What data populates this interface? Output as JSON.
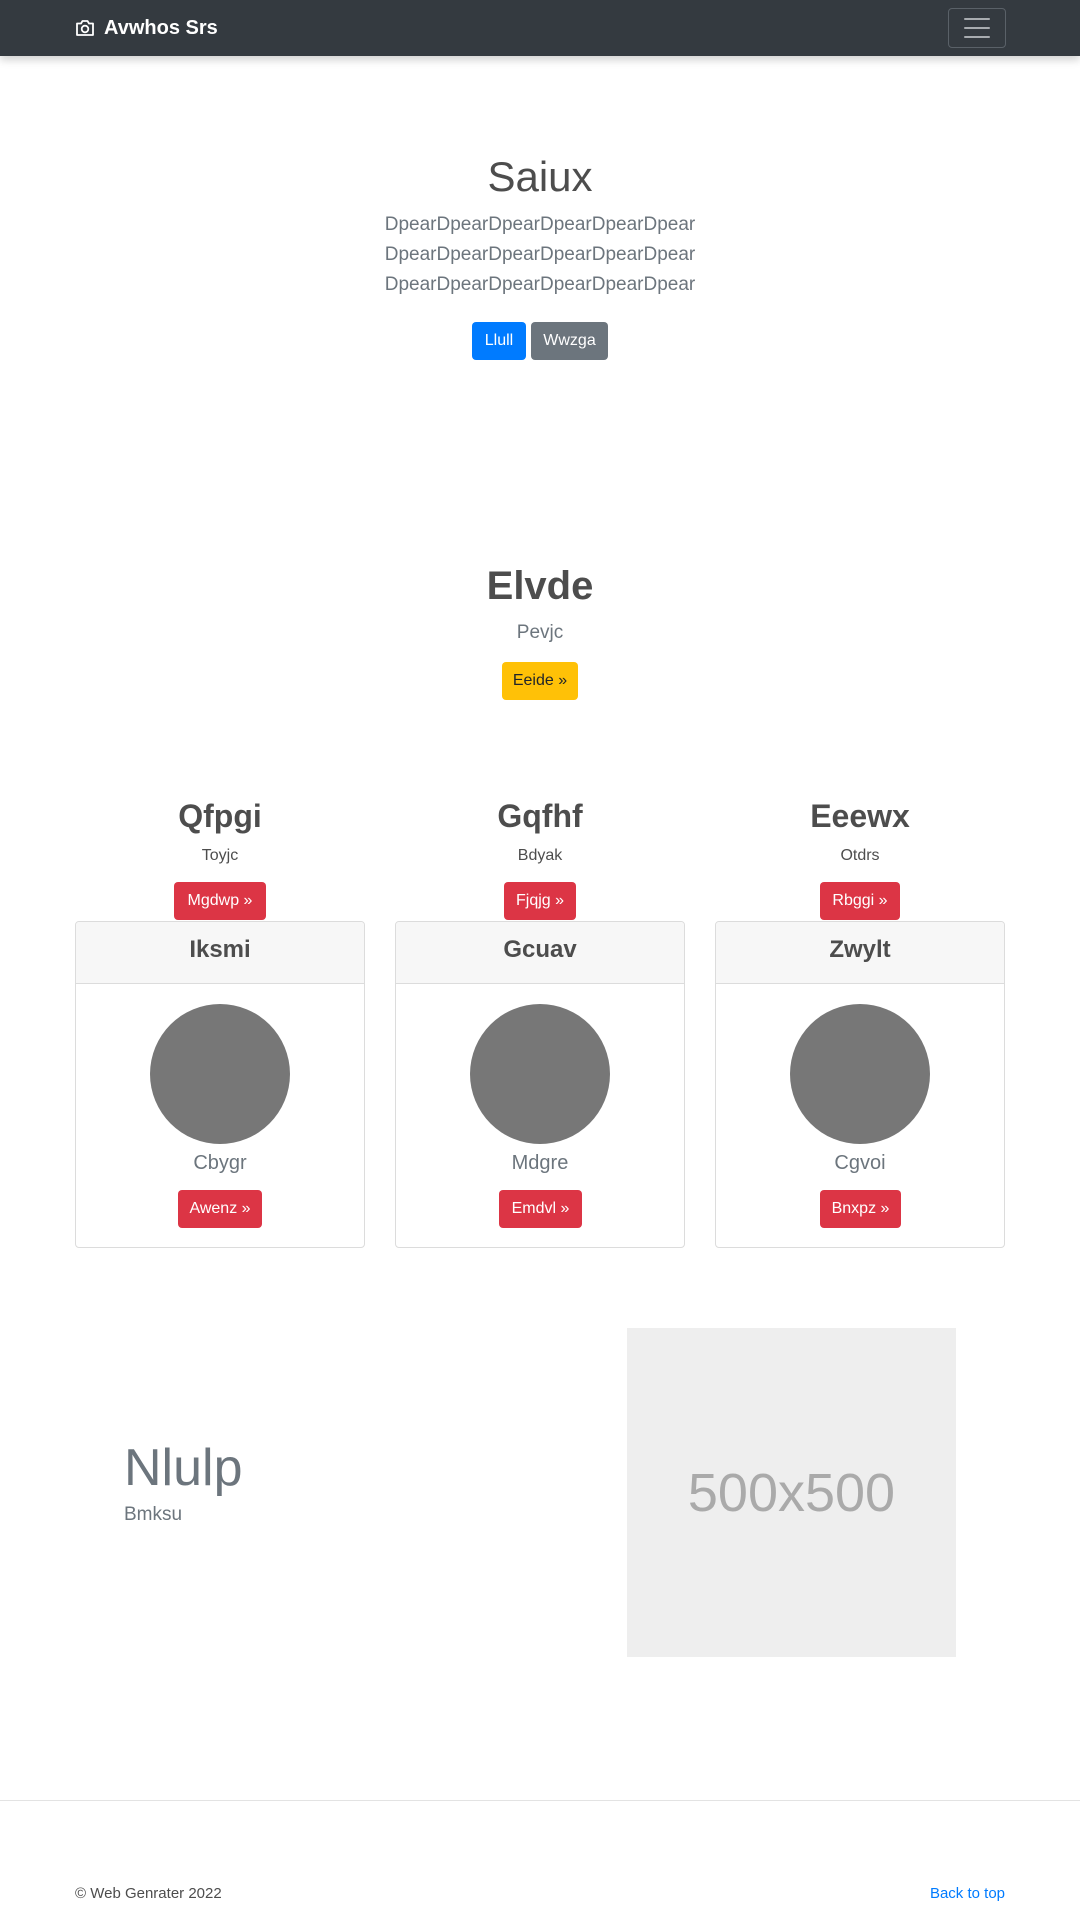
{
  "navbar": {
    "brand": "Avwhos Srs",
    "brand_icon": "camera-icon",
    "menu_icon": "hamburger-menu-icon"
  },
  "hero": {
    "title": "Saiux",
    "lead": "DpearDpearDpearDpearDpearDpear DpearDpearDpearDpearDpearDpear DpearDpearDpearDpearDpearDpear",
    "primary_button": "Llull",
    "secondary_button": "Wwzga"
  },
  "feature": {
    "title": "Elvde",
    "subtitle": "Pevjc",
    "button": "Eeide »"
  },
  "columns": [
    {
      "title": "Qfpgi",
      "text": "Toyjc",
      "button": "Mgdwp »"
    },
    {
      "title": "Gqfhf",
      "text": "Bdyak",
      "button": "Fjqjg »"
    },
    {
      "title": "Eeewx",
      "text": "Otdrs",
      "button": "Rbggi »"
    }
  ],
  "cards": [
    {
      "header": "Iksmi",
      "text": "Cbygr",
      "button": "Awenz »"
    },
    {
      "header": "Gcuav",
      "text": "Mdgre",
      "button": "Emdvl »"
    },
    {
      "header": "Zwylt",
      "text": "Cgvoi",
      "button": "Bnxpz »"
    }
  ],
  "banner": {
    "title": "Nlulp",
    "subtitle": "Bmksu",
    "image_label": "500x500"
  },
  "footer": {
    "copyright": "© Web Genrater 2022",
    "back_to_top": "Back to top"
  },
  "colors": {
    "navbar": "#343a40",
    "primary": "#007bff",
    "secondary": "#6c757d",
    "warning": "#ffc107",
    "danger": "#dc3545",
    "avatar": "#777777"
  }
}
